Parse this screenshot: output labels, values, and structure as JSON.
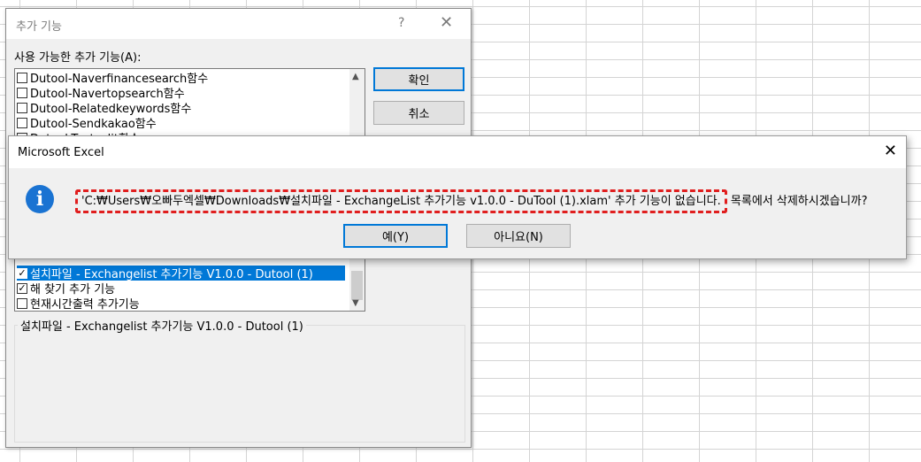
{
  "addins_dialog": {
    "title": "추가 기능",
    "help_glyph": "?",
    "close_glyph": "✕",
    "available_label": "사용 가능한 추가 기능(A):",
    "items_top": [
      {
        "label": "Dutool-Naverfinancesearch함수",
        "checked": false
      },
      {
        "label": "Dutool-Navertopsearch함수",
        "checked": false
      },
      {
        "label": "Dutool-Relatedkeywords함수",
        "checked": false
      },
      {
        "label": "Dutool-Sendkakao함수",
        "checked": false
      },
      {
        "label": "Dutool-Textsplit함수",
        "checked": false
      }
    ],
    "items_bottom": [
      {
        "label": "설치파일 - Exchangelist 추가기능 V1.0.0 - Dutool (1)",
        "checked": true,
        "selected": true
      },
      {
        "label": "해 찾기 추가 기능",
        "checked": true
      },
      {
        "label": "현재시간출력 추가기능",
        "checked": false
      }
    ],
    "ok_label": "확인",
    "cancel_label": "취소",
    "description": "설치파일 - Exchangelist 추가기능 V1.0.0 - Dutool (1)"
  },
  "message_box": {
    "title": "Microsoft Excel",
    "close_glyph": "✕",
    "message_highlighted": "'C:₩Users₩오빠두엑셀₩Downloads₩설치파일 - ExchangeList 추가기능 v1.0.0 - DuTool (1).xlam' 추가 기능이 없습니다.",
    "message_rest": " 목록에서 삭제하시겠습니까?",
    "yes_label": "예(Y)",
    "no_label": "아니요(N)"
  },
  "colors": {
    "selection": "#0078d7",
    "highlight_border": "#e01e1e",
    "info_icon": "#1a73d2"
  }
}
